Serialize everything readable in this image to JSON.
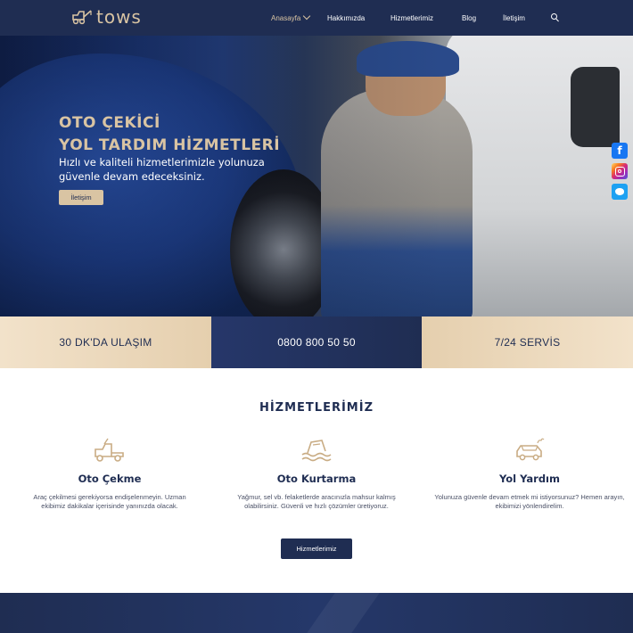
{
  "header": {
    "logo_text": "tows",
    "nav": [
      {
        "label": "Anasayfa",
        "active": true
      },
      {
        "label": "Hakkımızda"
      },
      {
        "label": "Hizmetlerimiz"
      },
      {
        "label": "Blog"
      },
      {
        "label": "İletişim"
      }
    ],
    "search_icon": "search-icon"
  },
  "hero": {
    "title_line1": "OTO ÇEKİCİ",
    "title_line2": "YOL TARDIM HİZMETLERİ",
    "description": "Hızlı ve kaliteli hizmetlerimizle yolunuza güvenle devam edeceksiniz.",
    "button_label": "İletişim"
  },
  "social": [
    "facebook-icon",
    "instagram-icon",
    "twitter-icon"
  ],
  "band": {
    "left": "30 DK'DA ULAŞIM",
    "middle": "0800 800 50 50",
    "right": "7/24 SERVİS"
  },
  "services": {
    "title": "HİZMETLERİMİZ",
    "items": [
      {
        "icon": "tow-truck-icon",
        "name": "Oto Çekme",
        "description": "Araç çekilmesi gerekiyorsa endişelenmeyin. Uzman ekibimiz dakikalar içerisinde yanınızda olacak."
      },
      {
        "icon": "flooded-car-icon",
        "name": "Oto Kurtarma",
        "description": "Yağmur, sel vb. felaketlerde aracınızla mahsur kalmış olabilirsiniz. Güvenli ve hızlı çözümler üretiyoruz."
      },
      {
        "icon": "car-breakdown-icon",
        "name": "Yol Yardım",
        "description": "Yolunuza güvenle devam etmek mi istiyorsunuz? Hemen arayın, ekibimizi yönlendirelim."
      }
    ],
    "button_label": "Hizmetlerimiz"
  },
  "colors": {
    "navy": "#1f2d52",
    "beige": "#d9c4a3",
    "band_beige": "#f2e2ca"
  }
}
